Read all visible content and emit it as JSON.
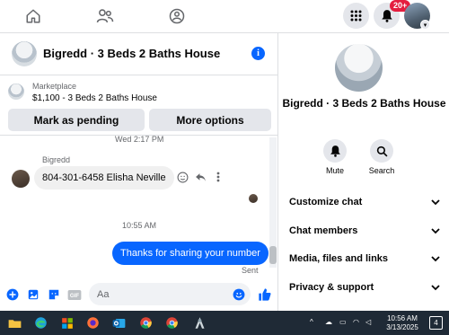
{
  "notifications": {
    "badge": "20+"
  },
  "chat": {
    "title": "Bigredd · 3 Beds 2 Baths House",
    "marketplace": {
      "label": "Marketplace",
      "listing": "$1,100 - 3 Beds 2 Baths House",
      "pending_label": "Mark as pending",
      "more_label": "More options"
    },
    "date_separator": "Wed 2:17 PM",
    "sender_name": "Bigredd",
    "incoming_message": "804-301-6458  Elisha Neville",
    "time_separator": "10:55 AM",
    "outgoing_message": "Thanks for sharing your number",
    "sent_status": "Sent",
    "composer_placeholder": "Aa"
  },
  "panel": {
    "title": "Bigredd · 3 Beds 2 Baths House",
    "mute_label": "Mute",
    "search_label": "Search",
    "sections": [
      {
        "label": "Customize chat"
      },
      {
        "label": "Chat members"
      },
      {
        "label": "Media, files and links"
      },
      {
        "label": "Privacy & support"
      }
    ]
  },
  "taskbar": {
    "time": "10:56 AM",
    "date": "3/13/2025",
    "notification_count": "4"
  },
  "colors": {
    "accent": "#0866ff",
    "badge": "#e41e3f",
    "taskbar": "#1f2a36"
  }
}
